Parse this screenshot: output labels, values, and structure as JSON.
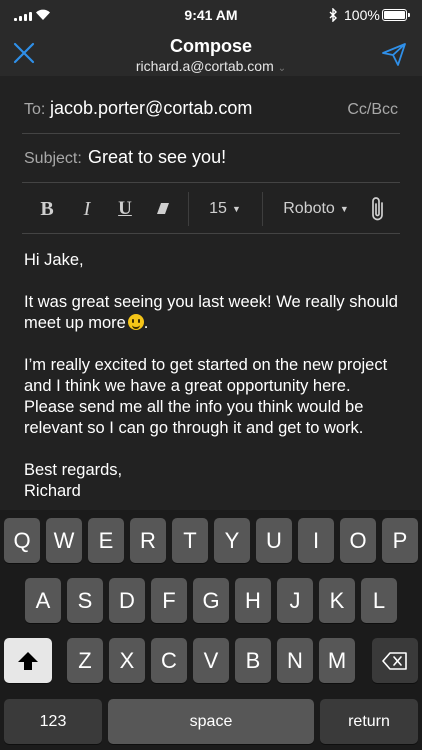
{
  "status_bar": {
    "time": "9:41 AM",
    "battery": "100%",
    "icons": [
      "signal-icon",
      "wifi-icon",
      "bluetooth-icon",
      "battery-icon"
    ]
  },
  "nav": {
    "title": "Compose",
    "account": "richard.a@cortab.com",
    "icons": [
      "close-icon",
      "send-icon"
    ]
  },
  "to": {
    "label": "To:",
    "value": "jacob.porter@cortab.com",
    "cc_bcc": "Cc/Bcc"
  },
  "subject": {
    "label": "Subject:",
    "value": "Great to see you!"
  },
  "toolbar": {
    "bold": "B",
    "italic": "I",
    "underline": "U",
    "size": "15",
    "font": "Roboto"
  },
  "body": {
    "greeting": "Hi Jake,",
    "para1": "It was great seeing you last week! We really should meet up more",
    "para2": "I’m really excited to get started on the new project and I think we have a great opportunity here. Please send me all the info you think would be relevant so I can go through it and get to work.",
    "signoff": "Best regards,",
    "name": "Richard"
  },
  "keyboard": {
    "row1": [
      "Q",
      "W",
      "E",
      "R",
      "T",
      "Y",
      "U",
      "I",
      "O",
      "P"
    ],
    "row2": [
      "A",
      "S",
      "D",
      "F",
      "G",
      "H",
      "J",
      "K",
      "L"
    ],
    "row3": [
      "Z",
      "X",
      "C",
      "V",
      "B",
      "N",
      "M"
    ],
    "numbers": "123",
    "space": "space",
    "return": "return"
  },
  "colors": {
    "accent": "#2f8fe8",
    "background": "#222222",
    "key": "#575757",
    "key_dark": "#3a3a3a"
  }
}
